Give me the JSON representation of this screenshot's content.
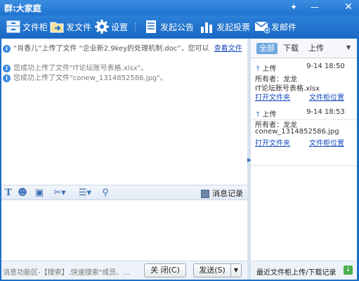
{
  "window": {
    "title": "群:大家庭",
    "pin_glyph": "✦",
    "min_glyph": "—",
    "close_glyph": "✕"
  },
  "toolbar": {
    "items": [
      {
        "label": "文件柜",
        "icon": "file-cabinet-icon"
      },
      {
        "label": "发文件",
        "icon": "send-file-icon"
      },
      {
        "label": "设置",
        "icon": "gear-icon"
      },
      {
        "label": "发起公告",
        "icon": "announcement-icon"
      },
      {
        "label": "发起投票",
        "icon": "vote-chart-icon"
      },
      {
        "label": "发邮件",
        "icon": "mail-icon"
      }
    ]
  },
  "messages": [
    {
      "text": "“肖香儿”上传了文件 “企业新2.9key的处理机制.doc”，您可以",
      "link": "查看文件"
    },
    {
      "text": "您成功上传了文件\"IT论坛账号表格.xlsx\"。"
    },
    {
      "text": "您成功上传了文件\"conew_1314852586.jpg\"。"
    }
  ],
  "format_bar": {
    "history_label": "消息记录"
  },
  "bottom": {
    "hint": "消息功能区-【搜索】,快速搜索\"成员、...",
    "close_label": "关 闭(C)",
    "send_label": "发送(S)",
    "send_arrow": "▼"
  },
  "file_panel": {
    "tabs": [
      "全部",
      "下载",
      "上传"
    ],
    "tab_dropdown": "▼",
    "entries": [
      {
        "type_label": "上传",
        "time": "9-14 18:50",
        "owner_label": "所有者：龙龙",
        "filename": "IT论坛账号表格.xlsx",
        "open_folder": "打开文件夹",
        "cabinet_pos": "文件柜位置"
      },
      {
        "type_label": "上传",
        "time": "9-14 18:53",
        "owner_label": "所有者：龙龙",
        "filename": "conew_1314852586.jpg",
        "open_folder": "打开文件夹",
        "cabinet_pos": "文件柜位置"
      }
    ],
    "footer_label": "最近文件柜上传/下载记录"
  },
  "colors": {
    "titlebar": "#2b80d8",
    "link": "#1a4fbf",
    "active_tab": "#6fa7df"
  }
}
